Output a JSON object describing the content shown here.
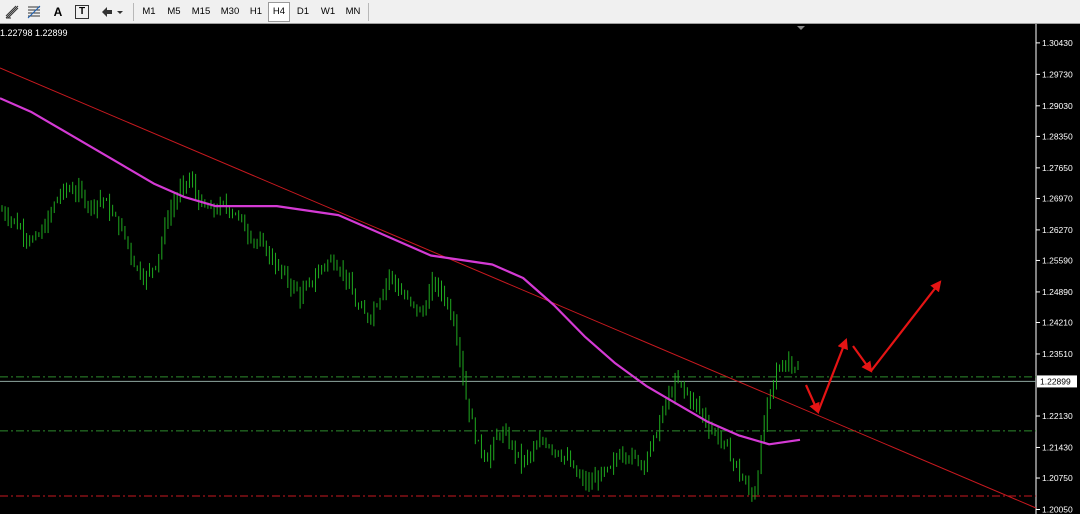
{
  "toolbar": {
    "tools": [
      {
        "name": "objects-list-icon"
      },
      {
        "name": "fibonacci-icon"
      },
      {
        "name": "text-tool-icon",
        "glyph": "A"
      },
      {
        "name": "text-label-icon",
        "glyph": "T"
      },
      {
        "name": "arrows-tool-icon"
      }
    ],
    "timeframes": [
      {
        "label": "M1",
        "active": false
      },
      {
        "label": "M5",
        "active": false
      },
      {
        "label": "M15",
        "active": false
      },
      {
        "label": "M30",
        "active": false
      },
      {
        "label": "H1",
        "active": false
      },
      {
        "label": "H4",
        "active": true
      },
      {
        "label": "D1",
        "active": false
      },
      {
        "label": "W1",
        "active": false
      },
      {
        "label": "MN",
        "active": false
      }
    ]
  },
  "chart": {
    "ohlc_text": "1.22798 1.22899",
    "current_price": "1.22899",
    "price_scale": [
      "1.30430",
      "1.29730",
      "1.29030",
      "1.28350",
      "1.27650",
      "1.26970",
      "1.26270",
      "1.25590",
      "1.24890",
      "1.24210",
      "1.23510",
      "1.22130",
      "1.21430",
      "1.20750",
      "1.20050"
    ],
    "colors": {
      "background": "#000000",
      "candles": "#1faa1f",
      "moving_average": "#d43ad4",
      "trendline": "#c8191f",
      "support_lines": "#2e8b2e",
      "low_line": "#c8191f",
      "forecast_arrows": "#e51414",
      "current_price_line": "#8fa7a0"
    }
  },
  "chart_data": {
    "type": "line",
    "title": "",
    "xlabel": "",
    "ylabel": "",
    "ylim": [
      1.1995,
      1.3085
    ],
    "price_series_approx": [
      1.267,
      1.265,
      1.262,
      1.26,
      1.264,
      1.27,
      1.272,
      1.271,
      1.268,
      1.27,
      1.266,
      1.262,
      1.255,
      1.252,
      1.256,
      1.266,
      1.271,
      1.274,
      1.268,
      1.267,
      1.268,
      1.267,
      1.263,
      1.26,
      1.258,
      1.254,
      1.251,
      1.248,
      1.251,
      1.255,
      1.256,
      1.253,
      1.246,
      1.243,
      1.247,
      1.253,
      1.249,
      1.246,
      1.244,
      1.251,
      1.248,
      1.242,
      1.225,
      1.215,
      1.212,
      1.218,
      1.215,
      1.211,
      1.213,
      1.216,
      1.214,
      1.212,
      1.208,
      1.206,
      1.208,
      1.209,
      1.214,
      1.212,
      1.211,
      1.216,
      1.224,
      1.229,
      1.226,
      1.223,
      1.219,
      1.216,
      1.212,
      1.207,
      1.203,
      1.221,
      1.231,
      1.234,
      1.232
    ],
    "moving_average_approx": [
      1.292,
      1.289,
      1.285,
      1.281,
      1.277,
      1.273,
      1.27,
      1.268,
      1.268,
      1.268,
      1.267,
      1.266,
      1.263,
      1.26,
      1.257,
      1.256,
      1.255,
      1.252,
      1.246,
      1.239,
      1.233,
      1.228,
      1.224,
      1.22,
      1.217,
      1.215,
      1.216
    ],
    "horizontal_levels": [
      1.23,
      1.218,
      1.2035
    ],
    "current_price": 1.22899
  }
}
